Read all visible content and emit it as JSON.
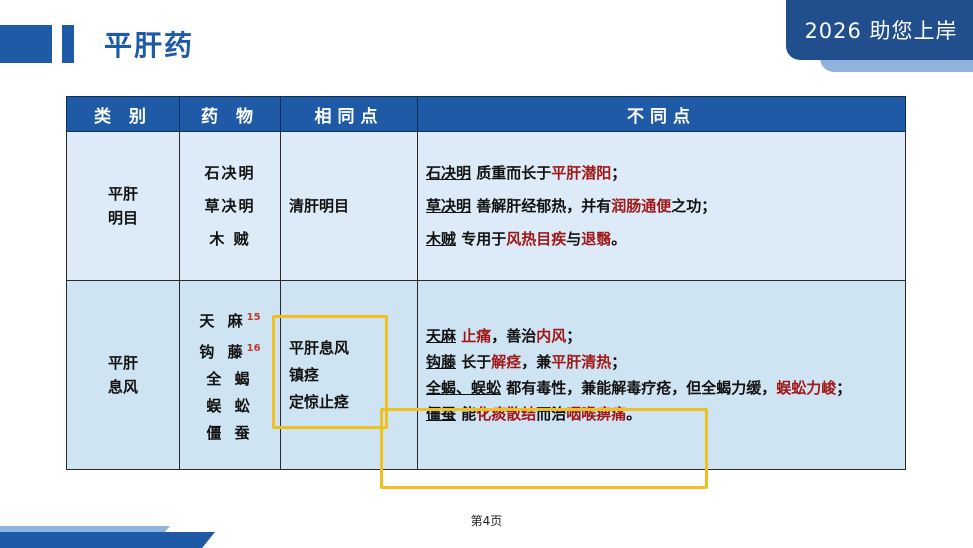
{
  "title": "平肝药",
  "badge": "2026 助您上岸",
  "table": {
    "headers": [
      "类 别",
      "药 物",
      "相同点",
      "不同点"
    ],
    "row1": {
      "category": [
        "平肝",
        "明目"
      ],
      "drugs": [
        "石决明",
        "草决明",
        "木 贼"
      ],
      "same": [
        "清肝明目"
      ],
      "diff": [
        {
          "drug": "石决明",
          "t1": " 质重而长于",
          "r1": "平肝潜阳",
          "t2": "；"
        },
        {
          "drug": "草决明",
          "t1": " 善解肝经郁热，并有",
          "r1": "润肠通便",
          "t2": "之功；"
        },
        {
          "drug": "木贼",
          "t1": " 专用于",
          "r1": "风热目疾",
          "t2": "与",
          "r2": "退翳",
          "t3": "。"
        }
      ]
    },
    "row2": {
      "category": [
        "平肝",
        "息风"
      ],
      "drugs": [
        {
          "name": "天 麻",
          "sup": "15"
        },
        {
          "name": "钩 藤",
          "sup": "16"
        },
        {
          "name": "全 蝎",
          "sup": ""
        },
        {
          "name": "蜈 蚣",
          "sup": ""
        },
        {
          "name": "僵 蚕",
          "sup": ""
        }
      ],
      "same": [
        "平肝息风",
        "镇痉",
        "定惊止痉"
      ],
      "diff": [
        {
          "drug": "天麻",
          "t1": " ",
          "r1": "止痛",
          "t2": "，善治",
          "r2": "内风",
          "t3": "；"
        },
        {
          "drug": "钩藤",
          "t1": " 长于",
          "r1": "解痉",
          "t2": "，兼",
          "r2": "平肝清热",
          "t3": "；"
        },
        {
          "drug": "全蝎、蜈蚣",
          "t1": " 都有毒性，兼能解毒疗疮，但全蝎力缓，",
          "r1": "蜈蚣力峻",
          "t2": "；"
        },
        {
          "drug": "僵蚕",
          "t1": " 能",
          "r1": "化痰散结",
          "t2": "而治",
          "r2": "咽喉痹痛",
          "t3": "。"
        }
      ]
    }
  },
  "page_number": "第4页"
}
